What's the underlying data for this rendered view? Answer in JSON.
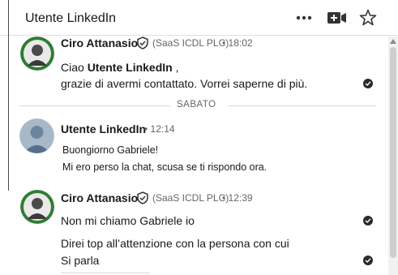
{
  "header": {
    "title": "Utente LinkedIn",
    "icons": [
      "more-options-icon",
      "video-call-icon",
      "star-icon"
    ]
  },
  "date_separator": "SABATO",
  "messages": [
    {
      "sender": "Ciro Attanasio",
      "company": "(SaaS ICDL PLC)",
      "time": "• 18:02",
      "greeting": "Ciao ",
      "greeting_name": "Utente LinkedIn",
      "greeting_end": " ,",
      "line2": "grazie di avermi contattato. Vorrei saperne di più."
    },
    {
      "sender": "Utente LinkedIn",
      "time": "• 12:14",
      "line1": "Buongiorno Gabriele!",
      "line2": "Mi ero perso la chat, scusa se ti rispondo ora."
    },
    {
      "sender": "Ciro Attanasio",
      "company": "(SaaS ICDL PLC)",
      "time": "• 12:39",
      "line1": "Non mi chiamo Gabriele io",
      "line2": "Direi top all’attenzione con la persona con cui",
      "line3": "Si parla"
    }
  ],
  "colors": {
    "text": "#191919",
    "meta": "#666666",
    "divider": "#e0e0e0",
    "avatar_bg": "#a7b8c9"
  }
}
